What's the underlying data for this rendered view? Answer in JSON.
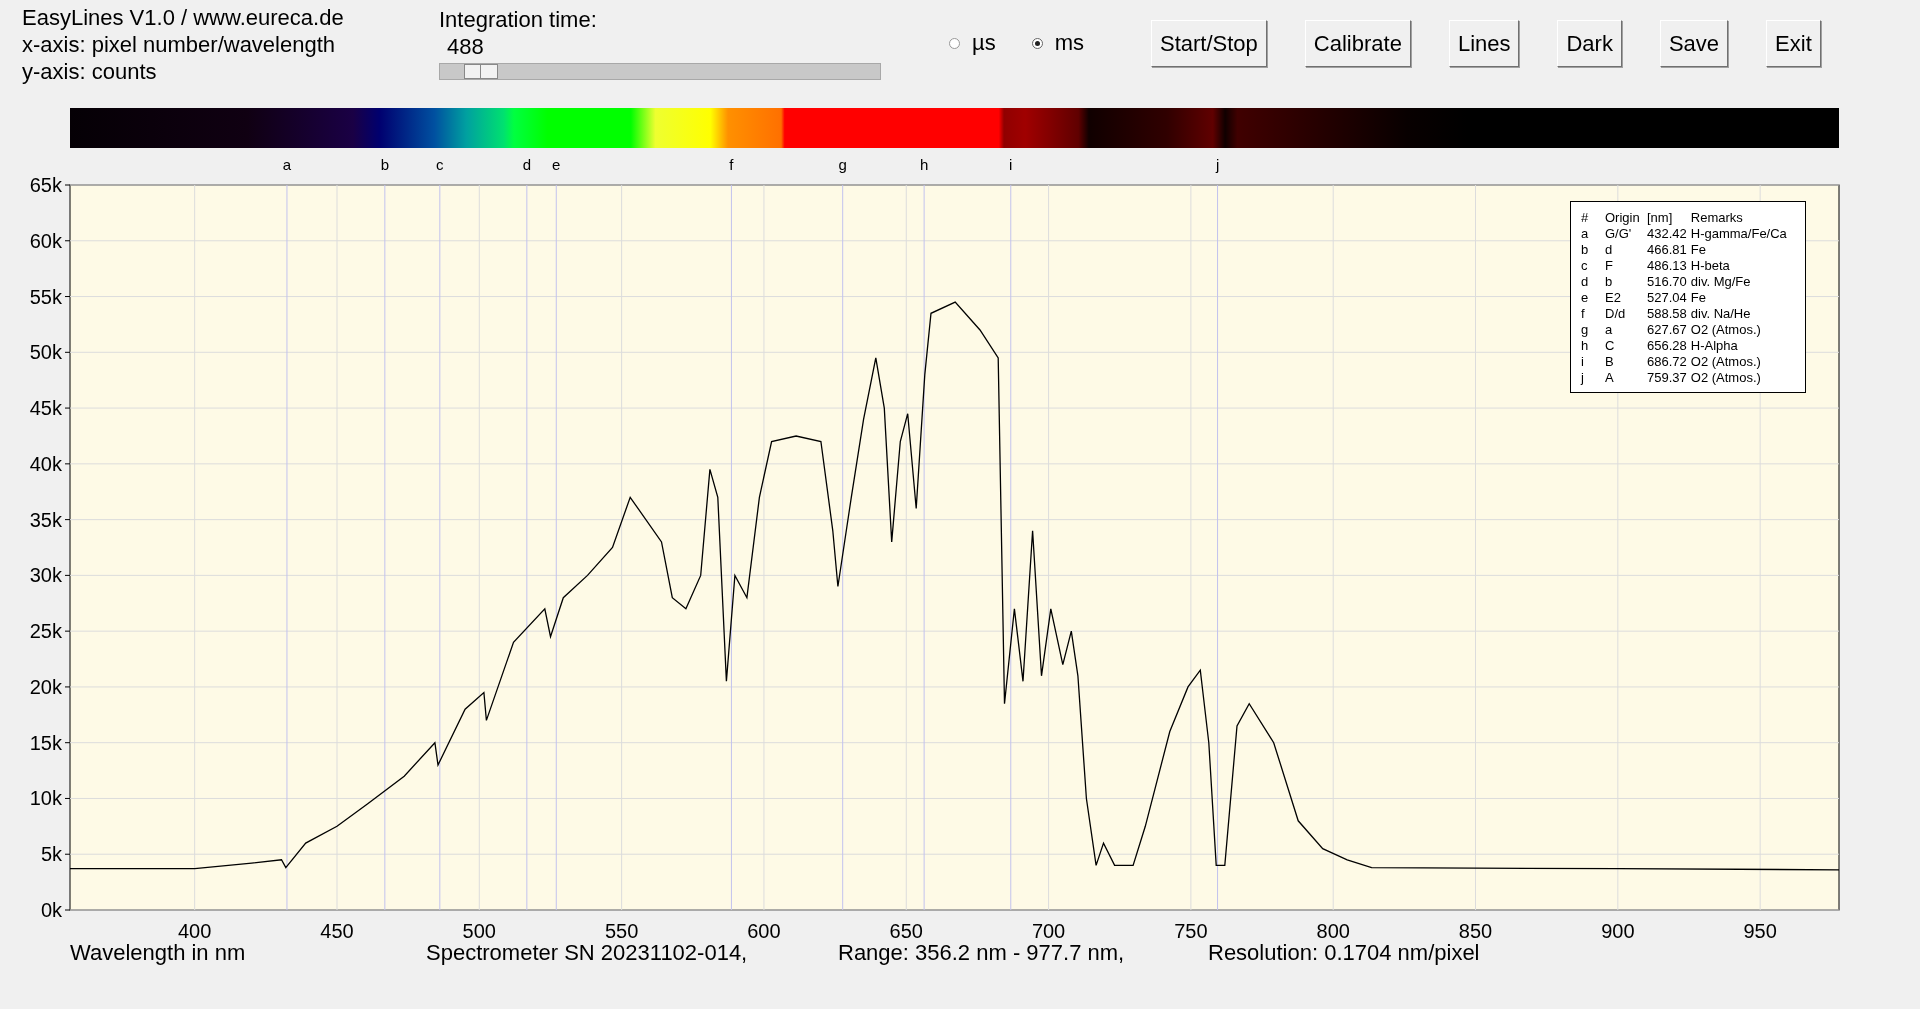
{
  "info_lines": [
    "EasyLines V1.0 / www.eureca.de",
    "x-axis: pixel number/wavelength",
    "y-axis: counts"
  ],
  "integration": {
    "label": "Integration time:",
    "value": "488",
    "level": 0.06
  },
  "unit_options": [
    {
      "label": "µs",
      "selected": false
    },
    {
      "label": "ms",
      "selected": true
    }
  ],
  "buttons": [
    "Start/Stop",
    "Calibrate",
    "Lines",
    "Dark",
    "Save",
    "Exit"
  ],
  "legend": {
    "columns": [
      "#",
      "Origin",
      "[nm]",
      "Remarks"
    ],
    "rows": [
      [
        "a",
        "G/G'",
        "432.42",
        "H-gamma/Fe/Ca"
      ],
      [
        "b",
        "d",
        "466.81",
        "Fe"
      ],
      [
        "c",
        "F",
        "486.13",
        "H-beta"
      ],
      [
        "d",
        "b",
        "516.70",
        "div. Mg/Fe"
      ],
      [
        "e",
        "E2",
        "527.04",
        "Fe"
      ],
      [
        "f",
        "D/d",
        "588.58",
        "div. Na/He"
      ],
      [
        "g",
        "a",
        "627.67",
        "O2 (Atmos.)"
      ],
      [
        "h",
        "C",
        "656.28",
        "H-Alpha"
      ],
      [
        "i",
        "B",
        "686.72",
        "O2 (Atmos.)"
      ],
      [
        "j",
        "A",
        "759.37",
        "O2 (Atmos.)"
      ]
    ]
  },
  "chart_data": {
    "type": "line",
    "xlim": [
      356.2,
      977.7
    ],
    "ylim": [
      0,
      65000
    ],
    "xticks": [
      400,
      450,
      500,
      550,
      600,
      650,
      700,
      750,
      800,
      850,
      900,
      950
    ],
    "yticks": [
      {
        "value": 0,
        "label": "0k"
      },
      {
        "value": 5000,
        "label": "5k"
      },
      {
        "value": 10000,
        "label": "10k"
      },
      {
        "value": 15000,
        "label": "15k"
      },
      {
        "value": 20000,
        "label": "20k"
      },
      {
        "value": 25000,
        "label": "25k"
      },
      {
        "value": 30000,
        "label": "30k"
      },
      {
        "value": 35000,
        "label": "35k"
      },
      {
        "value": 40000,
        "label": "40k"
      },
      {
        "value": 45000,
        "label": "45k"
      },
      {
        "value": 50000,
        "label": "50k"
      },
      {
        "value": 55000,
        "label": "55k"
      },
      {
        "value": 60000,
        "label": "60k"
      },
      {
        "value": 65000,
        "label": "65k"
      }
    ],
    "x": [
      356.2,
      380,
      400,
      420,
      430.5,
      432,
      439,
      450,
      460.7,
      473.6,
      484.4,
      485.5,
      495,
      501.6,
      502.5,
      512,
      523,
      525,
      529.5,
      538,
      546.8,
      553,
      564,
      567.8,
      572.6,
      577.8,
      581,
      583.8,
      586.8,
      589.8,
      594,
      598.4,
      602.7,
      611.3,
      620,
      624.2,
      626,
      630.7,
      635,
      639.3,
      642.3,
      644.9,
      647.9,
      650.5,
      653.5,
      656.5,
      658.7,
      667.2,
      675.9,
      682.3,
      684.5,
      688,
      691,
      694.4,
      697.5,
      700.8,
      705,
      708,
      710.3,
      713.3,
      716.7,
      719.3,
      723.2,
      729.7,
      734,
      742.6,
      749,
      753.3,
      756.3,
      758.9,
      761.9,
      766.2,
      770.5,
      779.1,
      787.7,
      796.3,
      804.9,
      813.5,
      900,
      977.7
    ],
    "grid": true,
    "series": [
      {
        "color": "#000000",
        "values": [
          3700,
          3700,
          3700,
          4200,
          4500,
          3800,
          6000,
          7500,
          9500,
          12000,
          15000,
          13000,
          18000,
          19500,
          17000,
          24000,
          27000,
          24500,
          28000,
          30000,
          32500,
          37000,
          33000,
          28000,
          27000,
          30000,
          39500,
          37000,
          20500,
          30000,
          28000,
          37000,
          42000,
          42500,
          42000,
          34000,
          29000,
          37000,
          44000,
          49500,
          45000,
          33000,
          42000,
          44500,
          36000,
          48000,
          53500,
          54500,
          52000,
          49500,
          18500,
          27000,
          20500,
          34000,
          21000,
          27000,
          22000,
          25000,
          21000,
          10000,
          4000,
          6000,
          4000,
          4000,
          7500,
          16000,
          20000,
          21500,
          15000,
          4000,
          4000,
          16500,
          18500,
          15000,
          8000,
          5500,
          4500,
          3800,
          3700,
          3600
        ]
      }
    ],
    "ref_lines": [
      {
        "axis": "x",
        "value": 432.42,
        "label": "a"
      },
      {
        "axis": "x",
        "value": 466.81,
        "label": "b"
      },
      {
        "axis": "x",
        "value": 486.13,
        "label": "c"
      },
      {
        "axis": "x",
        "value": 516.7,
        "label": "d"
      },
      {
        "axis": "x",
        "value": 527.04,
        "label": "e"
      },
      {
        "axis": "x",
        "value": 588.58,
        "label": "f"
      },
      {
        "axis": "x",
        "value": 627.67,
        "label": "g"
      },
      {
        "axis": "x",
        "value": 656.28,
        "label": "h"
      },
      {
        "axis": "x",
        "value": 686.72,
        "label": "i"
      },
      {
        "axis": "x",
        "value": 759.37,
        "label": "j"
      }
    ]
  },
  "footer": [
    "Wavelength in nm",
    "Spectrometer SN 20231102-014,",
    "Range: 356.2 nm - 977.7 nm,",
    "Resolution: 0.1704 nm/pixel"
  ]
}
